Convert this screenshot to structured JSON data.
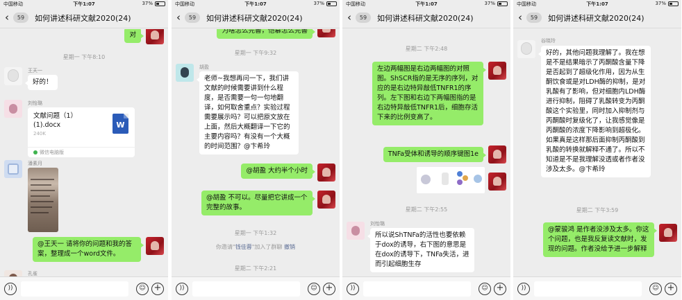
{
  "status": {
    "carrier": "中国移动",
    "battery": "37%",
    "times": [
      "下午1:07",
      "下午1:07",
      "下午1:07",
      "下午1:07"
    ]
  },
  "nav": {
    "back_icon": "chevron-left-icon",
    "unread_count": "59",
    "title": "如何讲述科研文献2020(24)"
  },
  "screen1": {
    "top_bubble": "对",
    "timestamp": "星期一 下午8:10",
    "msg1": {
      "sender": "王天一",
      "text": "好的！"
    },
    "file": {
      "sender": "刘怡璐",
      "name": "文献问题（1）\n(1).docx",
      "size": "240K",
      "source": "微信电脑版",
      "icon": "W"
    },
    "photo_sender": "潘素月",
    "msg2": "@王天一 请将你的问题和我的答案，整理成一个word文件。",
    "bottom_sender": "孔雀"
  },
  "screen2": {
    "top_bubble": "为啥怎么完善，恺慕怎么完善",
    "timestamp1": "星期一 下午9:32",
    "msg1": {
      "sender": "胡盈",
      "text": "老师~我想再问一下，我们讲文献的时候需要讲到什么程度，是否需要一句一句地翻译，如何取舍重点？实验过程需要展示吗？可以把原文放在上面，然后大概翻译一下它的主要内容吗？有没有一个大概的时间范围？@卞希玲"
    },
    "msg2": "@胡盈 大约半个小时",
    "msg3": "@胡盈  不可以。尽量把它讲成一个完整的故事。",
    "timestamp2": "星期一 下午1:32",
    "sys_prefix": "你邀请\"",
    "sys_name": "钱佳蓉",
    "sys_suffix": "\"加入了群聊",
    "sys_action": "撤销",
    "timestamp3": "星期二 下午2:21"
  },
  "screen3": {
    "timestamp1": "星期二 下午2:48",
    "msg1": "左边两幅图是右边两幅图的对照图。ShSCR指的是无序的序列，对应的是右边特异敲低TNFR1的序列。左下图和右边下两幅图指的是右边特异敲低TNFR1后，细胞存活下来的比例变高了。",
    "msg2": "TNFa受体和诱导的顺序键图1e",
    "timestamp2": "星期二 下午2:55",
    "msg3": {
      "sender": "刘怡璐",
      "text": "所以说ShTNFa的活性也要依赖于dox的诱导，右下图的意思是在dox的诱导下，TNFa失活，进而引起细胞生存"
    }
  },
  "screen4": {
    "msg1": {
      "sender": "谷晓玲",
      "text": "好的，其他问题我理解了。我在想是不是结果暗示了丙酮酸含量下降是否起到了超级化作用，因为从生酮饮食或是对LDH酶的抑制，是对乳酸有了影响，但对细胞内LDH酶进行抑制，阻碍了乳酸转变为丙酮酸这个实验里，同时加入抑制剂与丙酮酸时复级化了，让我感觉像是丙酮酸的浓度下降影响到超极化。如果真是这样那后面抑制丙酮酸到乳酸的转换就解释不通了。所以不知道是不是我理解没透或者作者没涉及太多。@卞希玲"
    },
    "timestamp": "星期二 下午3:59",
    "msg2": "@蒙骏鸿 是作者没涉及太多。你这个问题，也是我反复读文献时，发现的问题。作者没给予进一步解释"
  },
  "input_icons": [
    "voice-icon",
    "emoji-icon",
    "plus-icon"
  ]
}
